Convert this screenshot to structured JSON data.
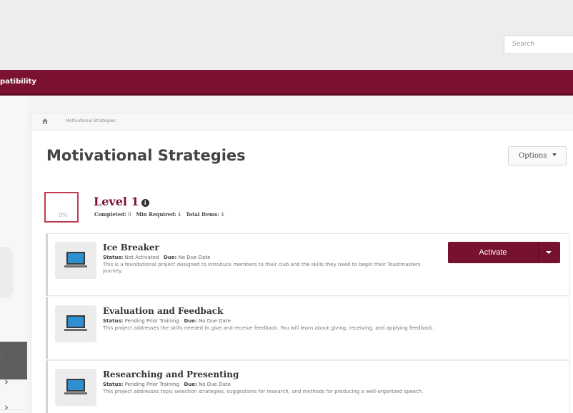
{
  "header": {
    "search_placeholder": "Search"
  },
  "nav": {
    "label": "patibility"
  },
  "breadcrumb": {
    "current": "Motivational Strategies"
  },
  "page": {
    "title": "Motivational Strategies",
    "options_label": "Options"
  },
  "level": {
    "progress": "0%",
    "title": "Level 1",
    "completed_label": "Completed:",
    "completed_value": "0",
    "min_required_label": "Min Required:",
    "min_required_value": "4",
    "total_items_label": "Total Items:",
    "total_items_value": "4"
  },
  "projects": [
    {
      "title": "Ice Breaker",
      "status_label": "Status:",
      "status": "Not Activated",
      "due_label": "Due:",
      "due": "No Due Date",
      "description": "This is a foundational project designed to introduce members to their club and the skills they need to begin their Toastmasters journey.",
      "action_label": "Activate"
    },
    {
      "title": "Evaluation and Feedback",
      "status_label": "Status:",
      "status": "Pending Prior Training",
      "due_label": "Due:",
      "due": "No Due Date",
      "description": "This project addresses the skills needed to give and receive feedback. You will learn about giving, receiving, and applying feedback."
    },
    {
      "title": "Researching and Presenting",
      "status_label": "Status:",
      "status": "Pending Prior Training",
      "due_label": "Due:",
      "due": "No Due Date",
      "description": "This project addresses topic selection strategies, suggestions for research, and methods for producing a well-organized speech."
    }
  ],
  "sidebar": {
    "chevrons": [
      "›",
      "›",
      "›"
    ]
  },
  "colors": {
    "brand": "#7a1230",
    "progress_border": "#c33a4e",
    "laptop_screen": "#2f8fd0"
  },
  "icons": [
    "home-icon",
    "info-icon",
    "laptop-icon",
    "caret-down-icon",
    "chevron-right-icon"
  ]
}
